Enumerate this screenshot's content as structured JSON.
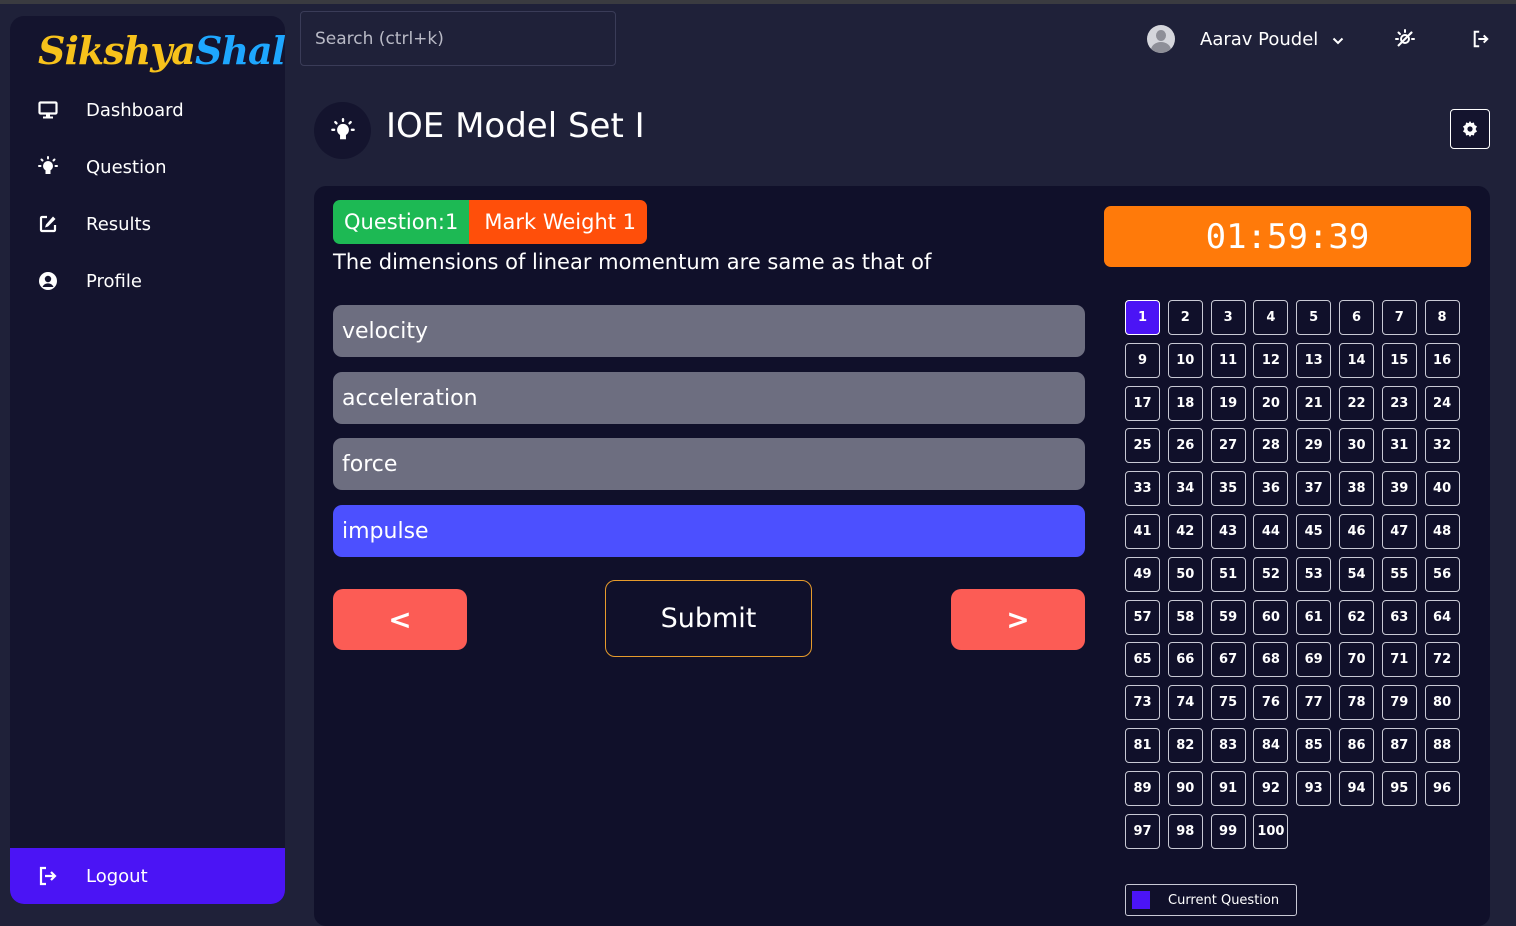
{
  "app": {
    "logo_part1": "Sikshya",
    "logo_part2": "Shala"
  },
  "sidebar": {
    "items": [
      {
        "label": "Dashboard",
        "icon": "monitor-icon"
      },
      {
        "label": "Question",
        "icon": "lightbulb-icon"
      },
      {
        "label": "Results",
        "icon": "edit-icon"
      },
      {
        "label": "Profile",
        "icon": "user-circle-icon"
      }
    ],
    "logout_label": "Logout"
  },
  "header": {
    "search_placeholder": "Search (ctrl+k)",
    "user_name": "Aarav Poudel"
  },
  "page": {
    "title": "IOE Model Set I"
  },
  "exam": {
    "question_badge": "Question:1",
    "weight_badge": "Mark Weight 1",
    "question_text": "The dimensions of linear momentum are same as that of",
    "options": [
      "velocity",
      "acceleration",
      "force",
      "impulse"
    ],
    "selected_option": "impulse",
    "prev_label": "<",
    "next_label": ">",
    "submit_label": "Submit",
    "timer": "01:59:39",
    "total_questions": 100,
    "current_question": 1,
    "legend_label": "Current Question"
  },
  "colors": {
    "accent": "#4b14f5",
    "selected_option": "#4c50ff",
    "timer": "#ff7a0a",
    "nav_button": "#fc5c55",
    "question_badge": "#1db954",
    "weight_badge": "#ff4f0a"
  }
}
